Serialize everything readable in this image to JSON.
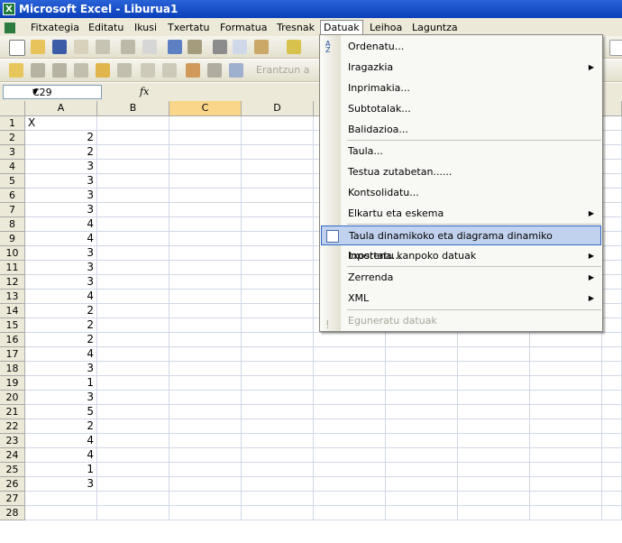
{
  "window": {
    "title": "Microsoft Excel - Liburua1"
  },
  "menubar": [
    "Fitxategia",
    "Editatu",
    "Ikusi",
    "Txertatu",
    "Formatua",
    "Tresnak",
    "Datuak",
    "Leihoa",
    "Laguntza"
  ],
  "toolbar2": {
    "reply_label": "Erantzun a"
  },
  "formula": {
    "cell_ref": "C29",
    "fx": "fx"
  },
  "columns": [
    "A",
    "B",
    "C",
    "D"
  ],
  "rows": [
    {
      "n": "1",
      "a": "X"
    },
    {
      "n": "2",
      "a": "2"
    },
    {
      "n": "3",
      "a": "2"
    },
    {
      "n": "4",
      "a": "3"
    },
    {
      "n": "5",
      "a": "3"
    },
    {
      "n": "6",
      "a": "3"
    },
    {
      "n": "7",
      "a": "3"
    },
    {
      "n": "8",
      "a": "4"
    },
    {
      "n": "9",
      "a": "4"
    },
    {
      "n": "10",
      "a": "3"
    },
    {
      "n": "11",
      "a": "3"
    },
    {
      "n": "12",
      "a": "3"
    },
    {
      "n": "13",
      "a": "4"
    },
    {
      "n": "14",
      "a": "2"
    },
    {
      "n": "15",
      "a": "2"
    },
    {
      "n": "16",
      "a": "2"
    },
    {
      "n": "17",
      "a": "4"
    },
    {
      "n": "18",
      "a": "3"
    },
    {
      "n": "19",
      "a": "1"
    },
    {
      "n": "20",
      "a": "3"
    },
    {
      "n": "21",
      "a": "5"
    },
    {
      "n": "22",
      "a": "2"
    },
    {
      "n": "23",
      "a": "4"
    },
    {
      "n": "24",
      "a": "4"
    },
    {
      "n": "25",
      "a": "1"
    },
    {
      "n": "26",
      "a": "3"
    },
    {
      "n": "27",
      "a": ""
    },
    {
      "n": "28",
      "a": ""
    }
  ],
  "menu": {
    "items": [
      {
        "label": "Ordenatu...",
        "submenu": false,
        "icon": "sort-icon"
      },
      {
        "label": "Iragazkia",
        "submenu": true
      },
      {
        "label": "Inprimakia...",
        "submenu": false
      },
      {
        "label": "Subtotalak...",
        "submenu": false
      },
      {
        "label": "Balidazioa...",
        "submenu": false
      },
      {
        "label": "Taula...",
        "submenu": false
      },
      {
        "label": "Testua zutabetan......",
        "submenu": false
      },
      {
        "label": "Kontsolidatu...",
        "submenu": false
      },
      {
        "label": "Elkartu eta eskema",
        "submenu": true
      },
      {
        "label": "Taula dinamikoko eta diagrama dinamiko txostena...",
        "submenu": false,
        "icon": "pivot-table-icon"
      },
      {
        "label": "Inportatu kanpoko datuak",
        "submenu": true
      },
      {
        "label": "Zerrenda",
        "submenu": true
      },
      {
        "label": "XML",
        "submenu": true
      },
      {
        "label": "Eguneratu datuak",
        "submenu": false,
        "icon": "refresh-icon",
        "disabled": true
      }
    ]
  },
  "colors": {
    "title_bar": "#0a3fb8",
    "menu_highlight": "#c1d2ee",
    "selected_col": "#f9d68a",
    "toolbar_bg": "#ece9d8"
  }
}
